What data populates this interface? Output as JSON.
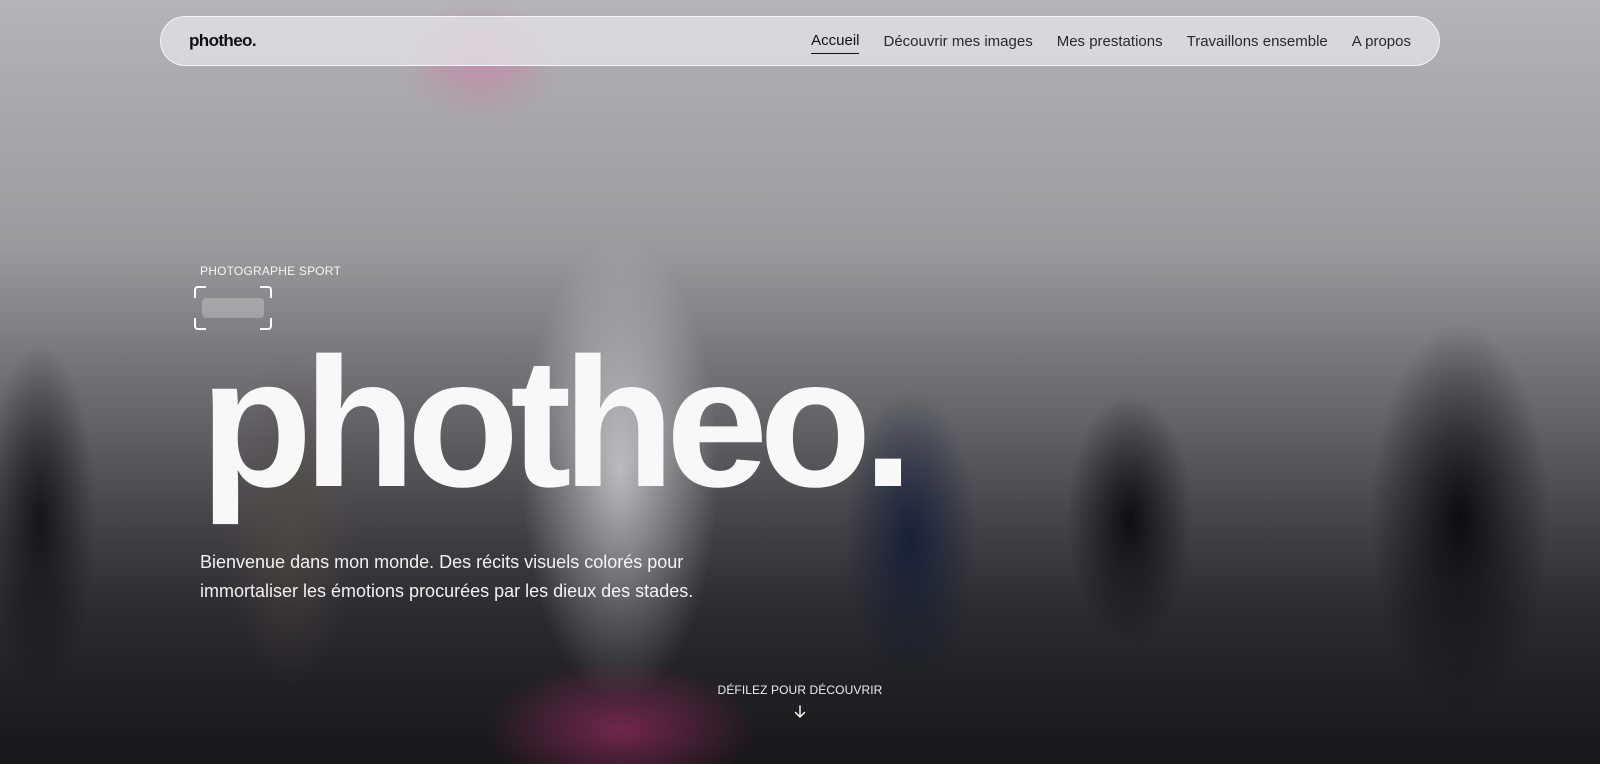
{
  "header": {
    "brand_name": "photheo",
    "brand_dot": ".",
    "nav": [
      {
        "label": "Accueil",
        "active": true
      },
      {
        "label": "Découvrir mes images",
        "active": false
      },
      {
        "label": "Mes prestations",
        "active": false
      },
      {
        "label": "Travaillons ensemble",
        "active": false
      },
      {
        "label": "A propos",
        "active": false
      }
    ]
  },
  "hero": {
    "eyebrow": "PHOTOGRAPHE SPORT",
    "title": "photheo",
    "title_dot": ".",
    "description": "Bienvenue dans mon monde. Des récits visuels colorés pour immortaliser les émotions procurées par les dieux des stades.",
    "scroll_label": "DÉFILEZ POUR DÉCOUVRIR",
    "scroll_icon": "arrow-down-icon"
  },
  "colors": {
    "header_bg": "#e1e1e4",
    "text_dark": "#111111",
    "text_light": "#ffffff"
  }
}
